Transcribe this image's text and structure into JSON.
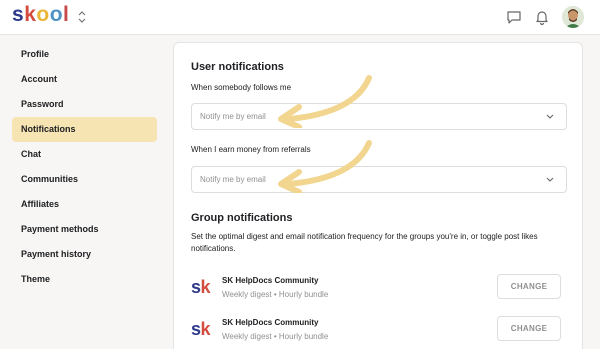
{
  "app": {
    "logo_letters": [
      {
        "char": "s",
        "color": "#2e3a8c"
      },
      {
        "char": "k",
        "color": "#d34c3f"
      },
      {
        "char": "o",
        "color": "#eab537"
      },
      {
        "char": "o",
        "color": "#4f92c6"
      },
      {
        "char": "l",
        "color": "#c64a4a"
      }
    ]
  },
  "topbar_icons": [
    "chat-icon",
    "bell-icon",
    "avatar"
  ],
  "sidebar": {
    "items": [
      {
        "label": "Profile",
        "active": false
      },
      {
        "label": "Account",
        "active": false
      },
      {
        "label": "Password",
        "active": false
      },
      {
        "label": "Notifications",
        "active": true
      },
      {
        "label": "Chat",
        "active": false
      },
      {
        "label": "Communities",
        "active": false
      },
      {
        "label": "Affiliates",
        "active": false
      },
      {
        "label": "Payment methods",
        "active": false
      },
      {
        "label": "Payment history",
        "active": false
      },
      {
        "label": "Theme",
        "active": false
      }
    ]
  },
  "user_notifications": {
    "title": "User notifications",
    "follows": {
      "label": "When somebody follows me",
      "placeholder": "Notify me by email"
    },
    "referrals": {
      "label": "When I earn money from referrals",
      "placeholder": "Notify me by email"
    }
  },
  "group_notifications": {
    "title": "Group notifications",
    "description": "Set the optimal digest and email notification frequency for the groups you're in, or toggle post likes notifications.",
    "groups": [
      {
        "icon_text": "sk",
        "name": "SK HelpDocs Community",
        "subtitle": "Weekly digest • Hourly bundle",
        "button": "CHANGE"
      },
      {
        "icon_text": "sk",
        "name": "SK HelpDocs Community",
        "subtitle": "Weekly digest • Hourly bundle",
        "button": "CHANGE"
      }
    ]
  },
  "colors": {
    "accent_highlight": "#f7e4b3",
    "arrow": "#f2d58f",
    "sk_s": "#2e3a8c",
    "sk_k": "#d34c3f"
  }
}
